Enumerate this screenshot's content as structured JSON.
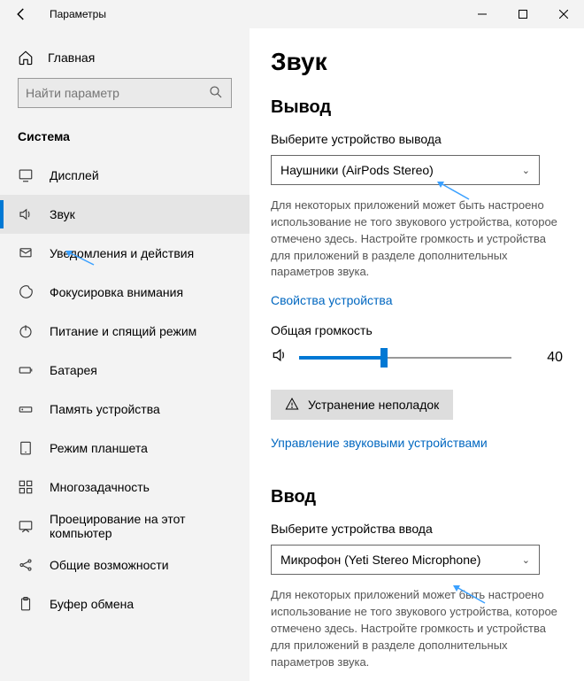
{
  "titlebar": {
    "title": "Параметры"
  },
  "sidebar": {
    "home_label": "Главная",
    "search_placeholder": "Найти параметр",
    "group_label": "Система",
    "items": [
      {
        "label": "Дисплей"
      },
      {
        "label": "Звук"
      },
      {
        "label": "Уведомления и действия"
      },
      {
        "label": "Фокусировка внимания"
      },
      {
        "label": "Питание и спящий режим"
      },
      {
        "label": "Батарея"
      },
      {
        "label": "Память устройства"
      },
      {
        "label": "Режим планшета"
      },
      {
        "label": "Многозадачность"
      },
      {
        "label": "Проецирование на этот компьютер"
      },
      {
        "label": "Общие возможности"
      },
      {
        "label": "Буфер обмена"
      }
    ]
  },
  "page": {
    "title": "Звук",
    "output": {
      "heading": "Вывод",
      "select_label": "Выберите устройство вывода",
      "selected": "Наушники (AirPods Stereo)",
      "description": "Для некоторых приложений может быть настроено использование не того звукового устройства, которое отмечено здесь. Настройте громкость и устройства для приложений в разделе дополнительных параметров звука.",
      "props_link": "Свойства устройства",
      "volume_label": "Общая громкость",
      "volume_value": "40",
      "troubleshoot": "Устранение неполадок",
      "manage_link": "Управление звуковыми устройствами"
    },
    "input": {
      "heading": "Ввод",
      "select_label": "Выберите устройства ввода",
      "selected": "Микрофон (Yeti Stereo Microphone)",
      "description": "Для некоторых приложений может быть настроено использование не того звукового устройства, которое отмечено здесь. Настройте громкость и устройства для приложений в разделе дополнительных параметров звука."
    }
  }
}
